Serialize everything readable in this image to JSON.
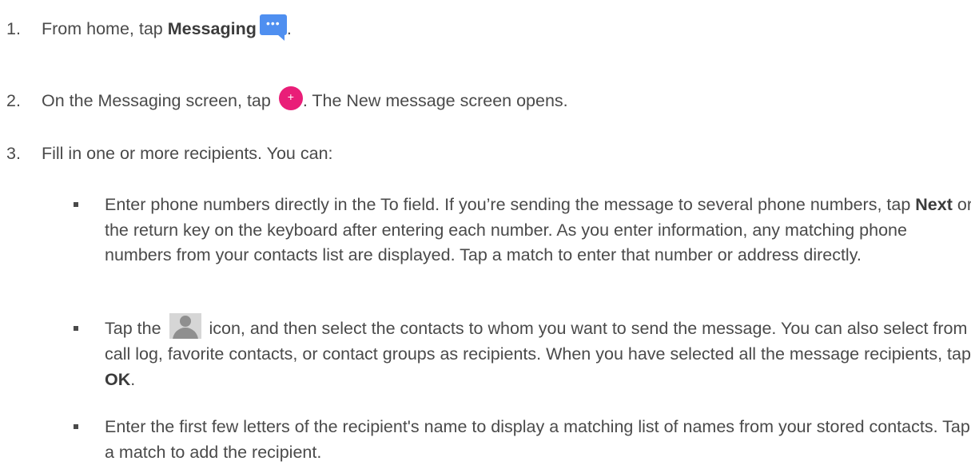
{
  "steps": [
    {
      "num": "1.",
      "pre": "From home, tap ",
      "bold": "Messaging",
      "post": "."
    },
    {
      "num": "2.",
      "pre": "On the Messaging screen, tap ",
      "post": ". The New message screen opens."
    },
    {
      "num": "3.",
      "text": "Fill in one or more recipients. You can:"
    }
  ],
  "bullets": [
    {
      "pre": "Enter phone numbers directly in the To field. If you’re sending the message to several phone numbers, tap ",
      "bold": "Next",
      "post": " or the return key on the keyboard after entering each number. As you enter information, any matching phone numbers from your contacts list are displayed. Tap a match to enter that number or address directly."
    },
    {
      "pre": "Tap the ",
      "mid": " icon, and then select the contacts to whom you want to send the message. You can also select from call log, favorite contacts, or contact groups as recipients. When you have selected all the message recipients, tap ",
      "bold": "OK",
      "post": "."
    },
    {
      "text": "Enter the first few letters of the recipient's name to display a matching list of names from your stored contacts. Tap a match to add the recipient."
    }
  ],
  "icons": {
    "messaging": {
      "name": "messaging-app-icon",
      "color": "#4f8ff0",
      "glyph": "•••"
    },
    "new_message": {
      "name": "new-message-plus-icon",
      "color": "#e91e78",
      "glyph": "+"
    },
    "contact": {
      "name": "contact-person-icon",
      "bg": "#d6d6d6",
      "fg": "#8f8f8f"
    }
  }
}
